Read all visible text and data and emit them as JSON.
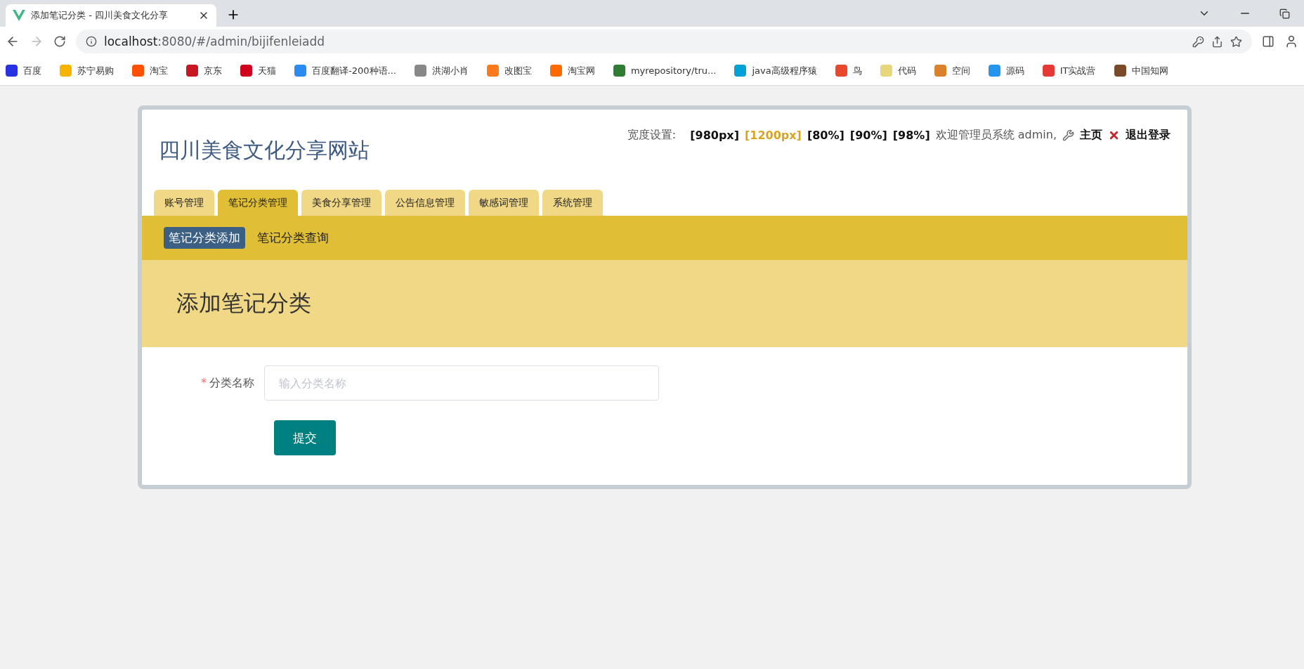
{
  "browser": {
    "tab_title": "添加笔记分类 - 四川美食文化分享",
    "url_host": "localhost",
    "url_rest": ":8080/#/admin/bijifenleiadd",
    "bookmarks": [
      {
        "label": "百度",
        "color": "#2932e1"
      },
      {
        "label": "苏宁易购",
        "color": "#f5b400"
      },
      {
        "label": "淘宝",
        "color": "#ff5000"
      },
      {
        "label": "京东",
        "color": "#c91623"
      },
      {
        "label": "天猫",
        "color": "#d0021b"
      },
      {
        "label": "百度翻译-200种语...",
        "color": "#2a8cf0"
      },
      {
        "label": "洪湖小肖",
        "color": "#888888"
      },
      {
        "label": "改图宝",
        "color": "#ff7a1a"
      },
      {
        "label": "淘宝网",
        "color": "#ff6a00"
      },
      {
        "label": "myrepository/tru...",
        "color": "#2e7d32"
      },
      {
        "label": "java高级程序猿",
        "color": "#00a1d6"
      },
      {
        "label": "鸟",
        "color": "#e8482c"
      },
      {
        "label": "代码",
        "color": "#e8d67a"
      },
      {
        "label": "空间",
        "color": "#d9822b"
      },
      {
        "label": "源码",
        "color": "#2496ed"
      },
      {
        "label": "IT实战营",
        "color": "#e53935"
      },
      {
        "label": "中国知网",
        "color": "#7a4b2a"
      }
    ]
  },
  "site": {
    "title": "四川美食文化分享网站",
    "width_label": "宽度设置:",
    "widths": [
      {
        "label": "[980px]",
        "selected": false
      },
      {
        "label": "[1200px]",
        "selected": true
      },
      {
        "label": "[80%]",
        "selected": false
      },
      {
        "label": "[90%]",
        "selected": false
      },
      {
        "label": "[98%]",
        "selected": false
      }
    ],
    "welcome": "欢迎管理员系统 admin,",
    "home": "主页",
    "logout": "退出登录"
  },
  "tabs": [
    {
      "label": "账号管理",
      "selected": false
    },
    {
      "label": "笔记分类管理",
      "selected": true
    },
    {
      "label": "美食分享管理",
      "selected": false
    },
    {
      "label": "公告信息管理",
      "selected": false
    },
    {
      "label": "敏感词管理",
      "selected": false
    },
    {
      "label": "系统管理",
      "selected": false
    }
  ],
  "subnav": [
    {
      "label": "笔记分类添加",
      "selected": true
    },
    {
      "label": "笔记分类查询",
      "selected": false
    }
  ],
  "page_title": "添加笔记分类",
  "form": {
    "fields": [
      {
        "label": "分类名称",
        "required": true,
        "required_mark": "*",
        "placeholder": "输入分类名称"
      }
    ],
    "submit": "提交"
  }
}
